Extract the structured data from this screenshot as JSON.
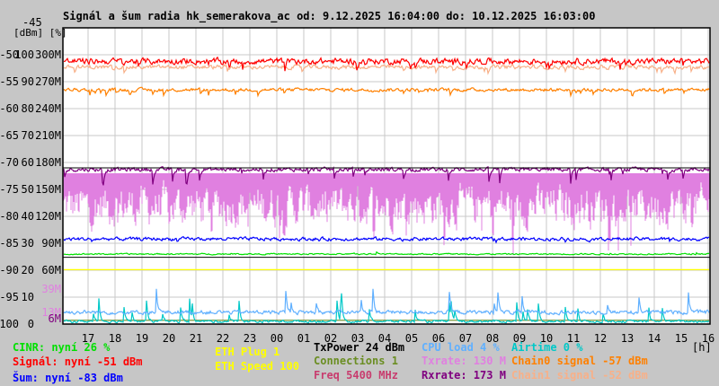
{
  "title": "Signál a šum radia hk_semerakova_ac od: 9.12.2025 16:04:00 do: 10.12.2025 16:03:00",
  "chart_data": {
    "type": "line",
    "title": "Signál a šum radia hk_semerakova_ac od: 9.12.2025 16:04:00 do: 10.12.2025 16:03:00",
    "xlabel": "[h]",
    "ylabel": "[dBm] [%]",
    "ylim": [
      -100,
      -45
    ],
    "x_start_hour": 16.067,
    "x_span_hours": 24,
    "x_ticks": [
      "17",
      "18",
      "19",
      "20",
      "21",
      "22",
      "23",
      "00",
      "01",
      "02",
      "03",
      "04",
      "05",
      "06",
      "07",
      "08",
      "09",
      "10",
      "11",
      "12",
      "13",
      "14",
      "15",
      "16"
    ],
    "y_top_label": "-45",
    "y_ticks": [
      {
        "dbm": "-50",
        "pct": "100",
        "rate": "300M",
        "v": -50
      },
      {
        "dbm": "-55",
        "pct": "90",
        "rate": "270M",
        "v": -55
      },
      {
        "dbm": "-60",
        "pct": "80",
        "rate": "240M",
        "v": -60
      },
      {
        "dbm": "-65",
        "pct": "70",
        "rate": "210M",
        "v": -65
      },
      {
        "dbm": "-70",
        "pct": "60",
        "rate": "180M",
        "v": -70
      },
      {
        "dbm": "-75",
        "pct": "50",
        "rate": "150M",
        "v": -75
      },
      {
        "dbm": "-80",
        "pct": "40",
        "rate": "120M",
        "v": -80
      },
      {
        "dbm": "-85",
        "pct": "30",
        "rate": "90M",
        "v": -85
      },
      {
        "dbm": "-90",
        "pct": "20",
        "rate": "60M",
        "v": -90
      },
      {
        "dbm": "-95",
        "pct": "10",
        "rate": "",
        "v": -95
      },
      {
        "dbm": "-100",
        "pct": "0",
        "rate": "",
        "v": -100
      }
    ],
    "secondary_ticks": [
      {
        "label": "39M",
        "color": "#e080e0",
        "v": -93.5
      },
      {
        "label": "13M",
        "color": "#e080e0",
        "v": -97.8
      },
      {
        "label": "6M",
        "color": "#800080",
        "v": -99
      }
    ],
    "grid": true,
    "series": [
      {
        "name": "Txrate",
        "color": "#e080e0",
        "level": -78,
        "jitter": 6,
        "spike": 0.04,
        "spikeSize": -8,
        "fill": true
      },
      {
        "name": "Rxrate",
        "color": "#800080",
        "level": -71.3,
        "jitter": 0.6,
        "spike": 0.05,
        "spikeSize": -4
      },
      {
        "name": "Chain1 signal",
        "color": "#f8b088",
        "level": -52.3,
        "jitter": 0.6,
        "spike": 0.02,
        "spikeSize": -1.5
      },
      {
        "name": "Signál",
        "color": "#ff0000",
        "level": -51.2,
        "jitter": 0.9,
        "spike": 0.03,
        "spikeSize": -2
      },
      {
        "name": "Chain0 signal",
        "color": "#ff8000",
        "level": -56.5,
        "jitter": 0.5,
        "spike": 0.03,
        "spikeSize": -1.5
      },
      {
        "name": "Šum",
        "color": "#0000ff",
        "level": -84.2,
        "jitter": 0.5,
        "spike": 0.02,
        "spikeSize": -0.8
      },
      {
        "name": "CINR",
        "color": "#00e000",
        "level": -87,
        "jitter": 0.2,
        "spike": 0.01,
        "spikeSize": 0.5
      },
      {
        "name": "ETH Speed",
        "color": "#ffff00",
        "level": -89.9,
        "jitter": 0,
        "spike": 0,
        "spikeSize": 0
      },
      {
        "name": "Connections",
        "color": "#6b8e23",
        "level": -99.3,
        "jitter": 0,
        "spike": 0,
        "spikeSize": 0
      },
      {
        "name": "Airtime",
        "color": "#00c8c8",
        "level": -99.5,
        "jitter": 0.4,
        "spike": 0.03,
        "spikeSize": 6
      },
      {
        "name": "CPU load",
        "color": "#60b0ff",
        "level": -97.8,
        "jitter": 0.6,
        "spike": 0.03,
        "spikeSize": 7
      }
    ]
  },
  "legend": {
    "cinr": "CINR: nyní 26 %",
    "signal": "Signál: nyní -51 dBm",
    "noise": "Šum: nyní -83 dBm",
    "eth_plug": "ETH Plug 1",
    "eth_speed": "ETH Speed 100",
    "txpower": "TxPower 24 dBm",
    "connections": "Connections 1",
    "freq": "Freq 5400 MHz",
    "cpu": "CPU load 4 %",
    "txrate": "Txrate: 130 M",
    "rxrate": "Rxrate: 173 M",
    "airtime": "Airtime 0 %",
    "chain0": "Chain0 signal -57 dBm",
    "chain1": "Chain1 signal -52 dBm",
    "unit_h": "[h]"
  },
  "colors": {
    "bg": "#c6c6c6",
    "grid": "#c8c8c8"
  }
}
